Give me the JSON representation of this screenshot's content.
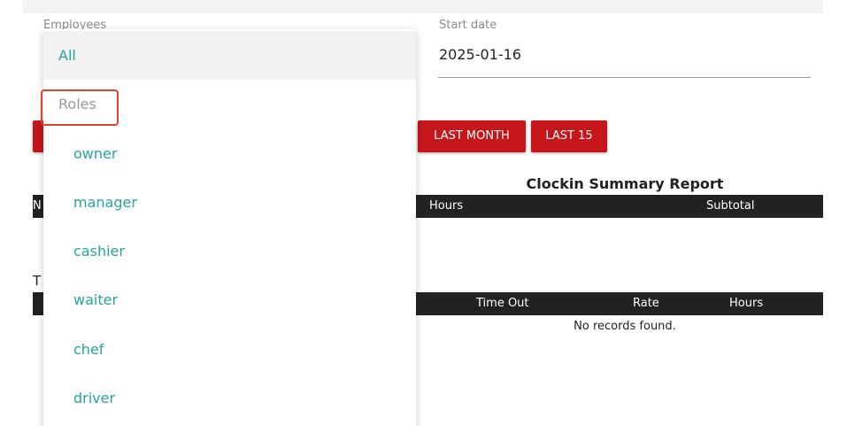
{
  "filters": {
    "employees_label": "Employees",
    "start_date_label": "Start date",
    "start_date_value": "2025-01-16"
  },
  "buttons": {
    "last_month": "LAST MONTH",
    "last_15": "LAST 15"
  },
  "report": {
    "title": "Clockin Summary Report",
    "summary_headers": {
      "hours": "Hours",
      "subtotal": "Subtotal"
    },
    "detail_headers": {
      "time_out": "Time Out",
      "rate": "Rate",
      "hours": "Hours"
    },
    "empty_message": "No records found.",
    "partial_n": "N",
    "partial_t": "T"
  },
  "dropdown": {
    "all": "All",
    "group_label": "Roles",
    "options": [
      "owner",
      "manager",
      "cashier",
      "waiter",
      "chef",
      "driver"
    ]
  },
  "colors": {
    "accent": "#26a69a",
    "button": "#c6161b",
    "header": "#222222",
    "highlight": "#e0452c"
  }
}
